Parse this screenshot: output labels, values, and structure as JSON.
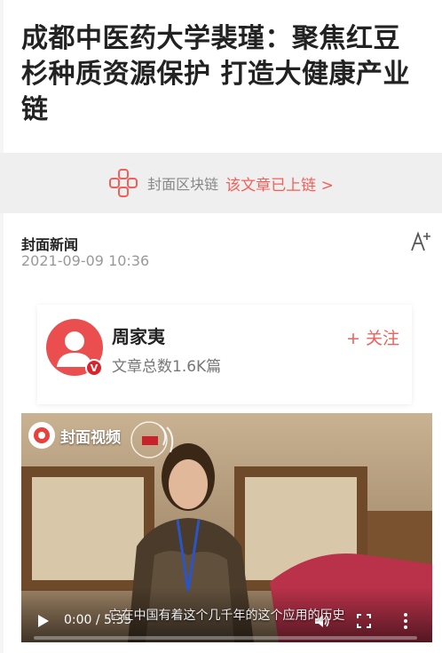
{
  "article": {
    "title": "成都中医药大学裴瑾：聚焦红豆杉种质资源保护 打造大健康产业链",
    "source": "封面新闻",
    "datetime": "2021-09-09 10:36"
  },
  "blockchain": {
    "label": "封面区块链",
    "link": "该文章已上链 >"
  },
  "author": {
    "name": "周家夷",
    "stats": "文章总数1.6K篇",
    "follow_label": "+ 关注",
    "verified_mark": "V"
  },
  "video": {
    "brand": "封面视频",
    "subtitle": "它在中国有着这个几千年的这个应用的历史",
    "time": "0:00 / 5:35",
    "progress": 0
  },
  "colors": {
    "accent": "#f0605a",
    "avatar_bg": "#ea4e4e",
    "verified": "#d8242a"
  },
  "icons": {
    "chain": "blockchain-icon",
    "font_size": "font-size-icon",
    "play": "play-icon",
    "volume": "volume-icon",
    "fullscreen": "fullscreen-icon",
    "more": "more-vertical-icon"
  }
}
